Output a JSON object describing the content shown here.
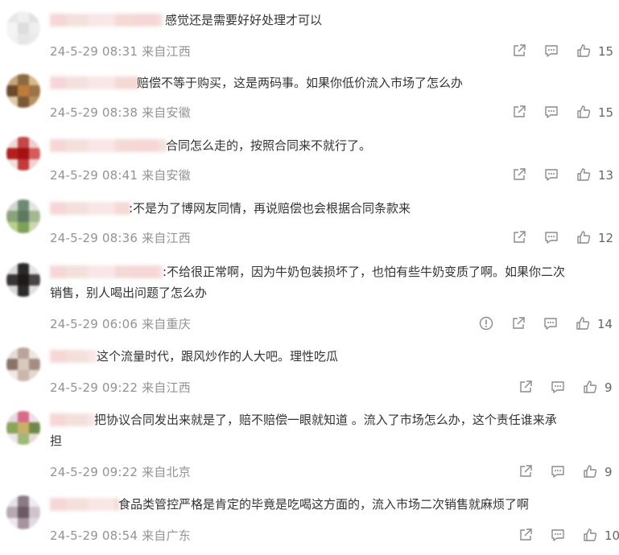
{
  "comments": [
    {
      "text": "感觉还是需要好好处理才可以",
      "time": "24-5-29 08:31",
      "location": "来自江西",
      "likes": "15",
      "avatar_colors": [
        "#e8e8e8",
        "#f0f0f0",
        "#e2e2e2",
        "#f4f4f4",
        "#dedede",
        "#eeeeee",
        "#f2f2f2",
        "#e6e6e6",
        "#eaeaea"
      ]
    },
    {
      "text": "赔偿不等于购买，这是两码事。如果你低价流入市场了怎么办",
      "time": "24-5-29 08:38",
      "location": "来自安徽",
      "likes": "15",
      "avatar_colors": [
        "#c9a57a",
        "#8a6a3f",
        "#d9b98a",
        "#6b4a2a",
        "#c07a3a",
        "#9b7448",
        "#e2caa6",
        "#7a5a36",
        "#b98f5e"
      ]
    },
    {
      "text": "合同怎么走的，按照合同来不就行了。",
      "time": "24-5-29 08:41",
      "location": "来自安徽",
      "likes": "13",
      "avatar_colors": [
        "#f0d8d8",
        "#c24848",
        "#ecd0d0",
        "#b51f1f",
        "#a31212",
        "#d65c5c",
        "#f1dede",
        "#c23a3a",
        "#eed2d2"
      ]
    },
    {
      "text": ":不是为了博网友同情，再说赔偿也会根据合同条款来",
      "time": "24-5-29 08:36",
      "location": "来自江西",
      "likes": "12",
      "avatar_colors": [
        "#cfd8cf",
        "#6e8a76",
        "#dfe6de",
        "#8aa47a",
        "#5c7a60",
        "#a4b890",
        "#b8d08a",
        "#7ea058",
        "#c9d8b0"
      ]
    },
    {
      "text_lines": [
        ":不给很正常啊，因为牛奶包装损坏了，也怕有些牛奶变质了啊。如果你二次",
        "销售，别人喝出问题了怎么办"
      ],
      "time": "24-5-29 06:06",
      "location": "来自重庆",
      "likes": "14",
      "avatar_colors": [
        "#dcdcdc",
        "#2a2a2a",
        "#e4e4e4",
        "#3a3636",
        "#1e1a1a",
        "#4a4444",
        "#d8d8d8",
        "#2e2a2a",
        "#e0e0e0"
      ]
    },
    {
      "text": "这个流量时代，跟风炒作的人大吧。理性吃瓜",
      "time": "24-5-29 09:22",
      "location": "来自江西",
      "likes": "9",
      "avatar_colors": [
        "#e6dcd6",
        "#b8a49a",
        "#efe6e0",
        "#8a7468",
        "#d8c8be",
        "#a48e84",
        "#f0e8e2",
        "#c9b7ac",
        "#e4d8d0"
      ]
    },
    {
      "text_lines": [
        "把协议合同发出来就是了，赔不赔偿一眼就知道 。流入了市场怎么办，这个责任谁来承",
        "担"
      ],
      "time": "24-5-29 09:22",
      "location": "来自北京",
      "likes": "9",
      "avatar_colors": [
        "#e6d8dc",
        "#d86a8a",
        "#efe0e4",
        "#8aa45a",
        "#c7b06a",
        "#6e8a4a",
        "#f0e4e8",
        "#a0b878",
        "#e8dcd4"
      ]
    },
    {
      "text": "食品类管控严格是肯定的毕竟是吃喝这方面的，流入市场二次销售就麻烦了啊",
      "time": "24-5-29 08:54",
      "location": "来自广东",
      "likes": "10",
      "avatar_colors": [
        "#e8e2e6",
        "#8a7a84",
        "#f0eaee",
        "#b8a8b2",
        "#6a5a64",
        "#d0c4cc",
        "#eee8ec",
        "#a4949e",
        "#e2dae0"
      ]
    }
  ],
  "icons": {
    "share": "share-icon",
    "reply": "comment-icon",
    "like": "thumbs-up-icon",
    "report": "report-icon"
  }
}
